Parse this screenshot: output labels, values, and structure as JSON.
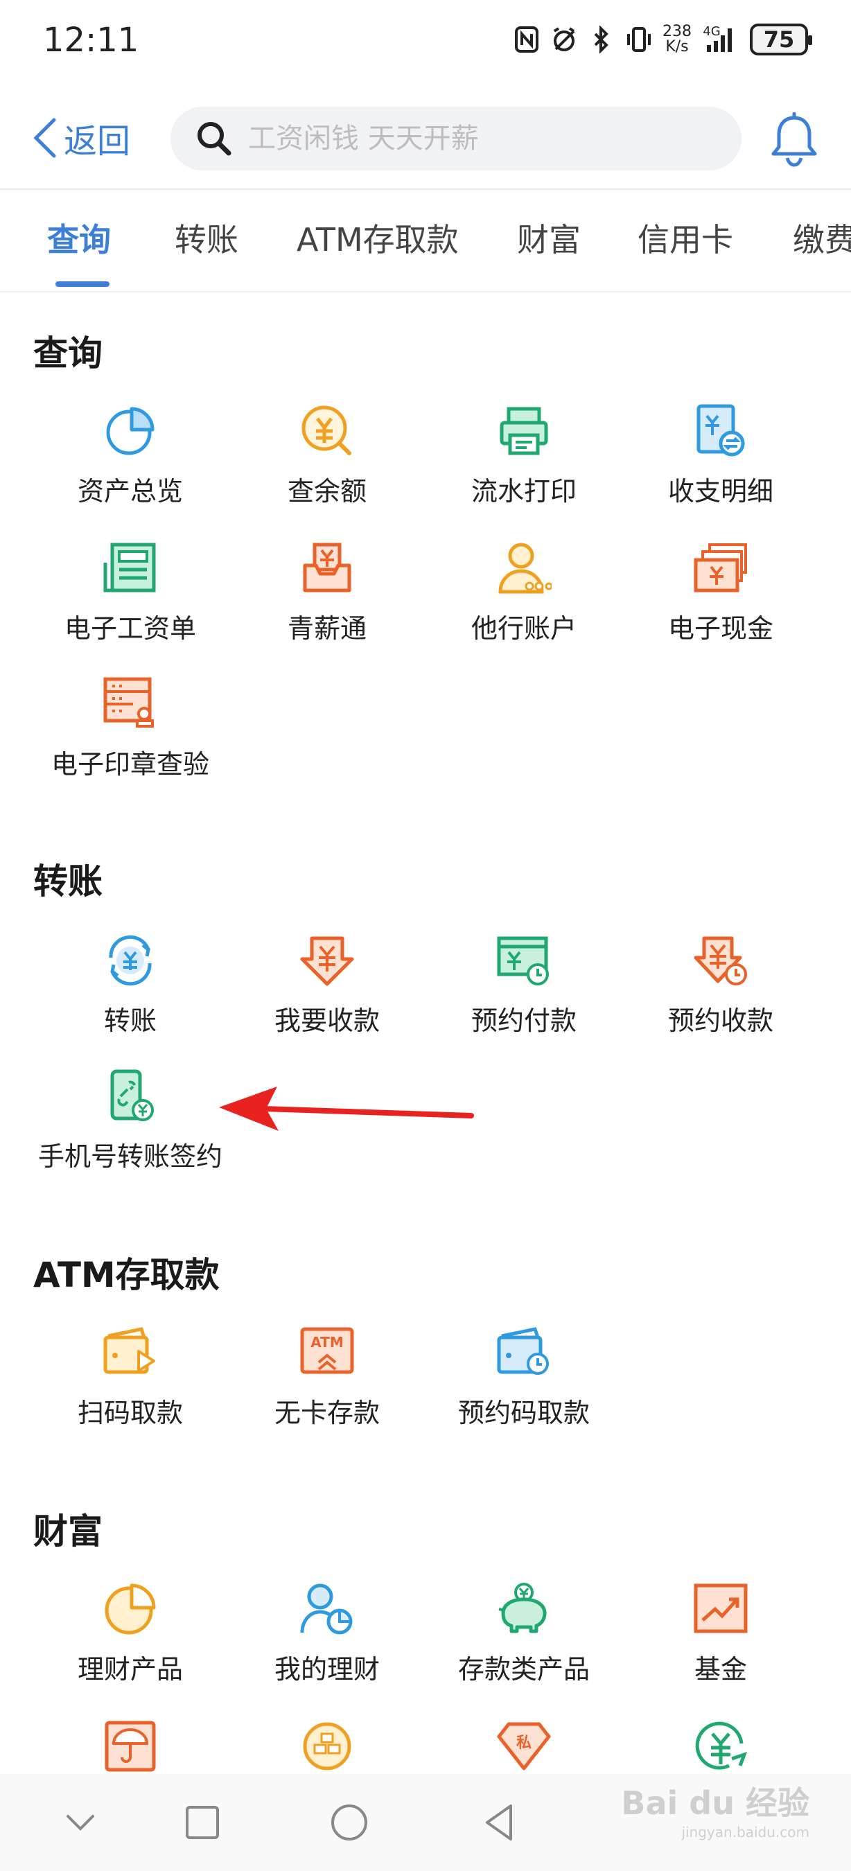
{
  "status": {
    "time": "12:11",
    "net_speed_top": "238",
    "net_speed_bottom": "K/s",
    "network": "4G",
    "battery": "75"
  },
  "header": {
    "back_label": "返回",
    "search_placeholder": "工资闲钱 天天开薪"
  },
  "tabs": [
    {
      "label": "查询",
      "active": true
    },
    {
      "label": "转账",
      "active": false
    },
    {
      "label": "ATM存取款",
      "active": false
    },
    {
      "label": "财富",
      "active": false
    },
    {
      "label": "信用卡",
      "active": false
    },
    {
      "label": "缴费",
      "active": false
    }
  ],
  "sections": {
    "query": {
      "title": "查询",
      "items": [
        {
          "label": "资产总览",
          "icon": "pie-chart-icon",
          "color": "#2f9ae0"
        },
        {
          "label": "查余额",
          "icon": "yuan-search-icon",
          "color": "#f0a020"
        },
        {
          "label": "流水打印",
          "icon": "printer-icon",
          "color": "#1fa870"
        },
        {
          "label": "收支明细",
          "icon": "bill-exchange-icon",
          "color": "#2f9ae0"
        },
        {
          "label": "电子工资单",
          "icon": "payslip-icon",
          "color": "#1fa870"
        },
        {
          "label": "青薪通",
          "icon": "salary-box-icon",
          "color": "#e8622a"
        },
        {
          "label": "他行账户",
          "icon": "user-account-icon",
          "color": "#f0a020"
        },
        {
          "label": "电子现金",
          "icon": "cash-cards-icon",
          "color": "#e8622a"
        },
        {
          "label": "电子印章查验",
          "icon": "seal-check-icon",
          "color": "#e8622a"
        }
      ]
    },
    "transfer": {
      "title": "转账",
      "items": [
        {
          "label": "转账",
          "icon": "yuan-cycle-icon",
          "color": "#2f9ae0"
        },
        {
          "label": "我要收款",
          "icon": "receive-money-icon",
          "color": "#e8622a"
        },
        {
          "label": "预约付款",
          "icon": "scheduled-pay-icon",
          "color": "#1fa870"
        },
        {
          "label": "预约收款",
          "icon": "scheduled-receive-icon",
          "color": "#e8622a"
        },
        {
          "label": "手机号转账签约",
          "icon": "phone-link-icon",
          "color": "#1fa870"
        }
      ]
    },
    "atm": {
      "title": "ATM存取款",
      "items": [
        {
          "label": "扫码取款",
          "icon": "wallet-play-icon",
          "color": "#f0a020"
        },
        {
          "label": "无卡存款",
          "icon": "atm-icon",
          "color": "#e8622a"
        },
        {
          "label": "预约码取款",
          "icon": "wallet-clock-icon",
          "color": "#2f9ae0"
        }
      ]
    },
    "wealth": {
      "title": "财富",
      "items": [
        {
          "label": "理财产品",
          "icon": "pie-product-icon",
          "color": "#f0a020"
        },
        {
          "label": "我的理财",
          "icon": "user-pie-icon",
          "color": "#2f9ae0"
        },
        {
          "label": "存款类产品",
          "icon": "piggy-bank-icon",
          "color": "#1fa870"
        },
        {
          "label": "基金",
          "icon": "trend-chart-icon",
          "color": "#e8622a"
        }
      ],
      "partial_icons": [
        {
          "icon": "umbrella-icon",
          "color": "#e8622a"
        },
        {
          "icon": "gold-icon",
          "color": "#f0a020"
        },
        {
          "icon": "private-diamond-icon",
          "color": "#e8622a",
          "text": "私"
        },
        {
          "icon": "yuan-refresh-icon",
          "color": "#1fa870"
        }
      ]
    }
  },
  "watermark": {
    "text": "Bai du 经验",
    "sub": "jingyan.baidu.com"
  },
  "annotation_color": "#e8231f"
}
